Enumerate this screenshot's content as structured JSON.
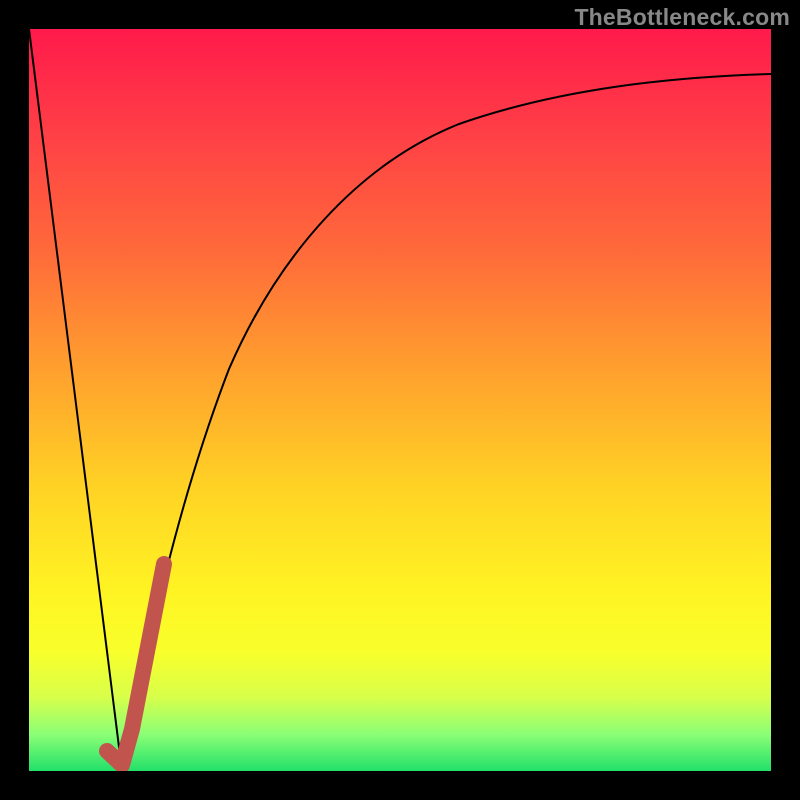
{
  "watermark": "TheBottleneck.com",
  "chart_data": {
    "type": "line",
    "title": "",
    "xlabel": "",
    "ylabel": "",
    "xlim": [
      0,
      1
    ],
    "ylim": [
      0,
      1
    ],
    "series": [
      {
        "name": "left-descent",
        "x": [
          0.0,
          0.125
        ],
        "y": [
          1.0,
          0.0
        ],
        "style": "thin-black"
      },
      {
        "name": "right-curve",
        "x": [
          0.125,
          0.18,
          0.22,
          0.27,
          0.33,
          0.4,
          0.48,
          0.58,
          0.7,
          0.85,
          1.0
        ],
        "y": [
          0.0,
          0.27,
          0.42,
          0.55,
          0.66,
          0.74,
          0.8,
          0.85,
          0.89,
          0.915,
          0.93
        ],
        "style": "thin-black"
      },
      {
        "name": "highlight-segment",
        "x": [
          0.105,
          0.125,
          0.138,
          0.18
        ],
        "y": [
          0.025,
          0.0,
          0.06,
          0.28
        ],
        "style": "thick-red"
      }
    ],
    "background_gradient": {
      "top": "#ff1a4b",
      "mid": "#ffd324",
      "bottom": "#22e06a"
    }
  }
}
